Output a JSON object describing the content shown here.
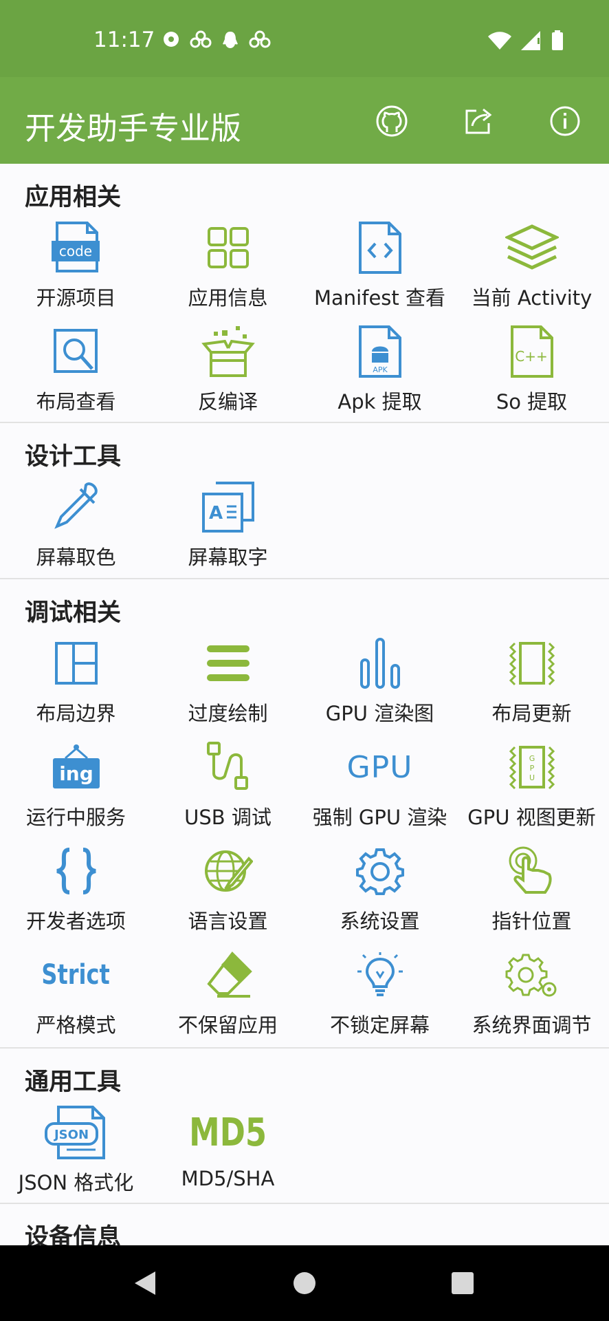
{
  "status": {
    "time": "11:17",
    "left_icons": [
      "record-icon",
      "cloud-icon",
      "qq-icon",
      "cloud-icon"
    ],
    "right_icons": [
      "wifi-icon",
      "signal-icon",
      "battery-icon"
    ]
  },
  "app": {
    "title": "开发助手专业版",
    "actions": [
      "github-icon",
      "share-icon",
      "info-icon"
    ]
  },
  "colors": {
    "green": "#71ab47",
    "green_dark": "#6ba443",
    "blue": "#3d8fd1",
    "lime": "#8cb83c"
  },
  "sections": [
    {
      "title": "应用相关",
      "items": [
        {
          "label": "开源项目",
          "icon": "code-file-icon"
        },
        {
          "label": "应用信息",
          "icon": "grid-icon"
        },
        {
          "label": "Manifest 查看",
          "icon": "code-doc-icon"
        },
        {
          "label": "当前 Activity",
          "icon": "layers-icon"
        },
        {
          "label": "布局查看",
          "icon": "layout-search-icon"
        },
        {
          "label": "反编译",
          "icon": "open-box-icon"
        },
        {
          "label": "Apk 提取",
          "icon": "apk-file-icon"
        },
        {
          "label": "So 提取",
          "icon": "cpp-file-icon"
        }
      ]
    },
    {
      "title": "设计工具",
      "items": [
        {
          "label": "屏幕取色",
          "icon": "eyedropper-icon"
        },
        {
          "label": "屏幕取字",
          "icon": "text-copy-icon"
        }
      ]
    },
    {
      "title": "调试相关",
      "items": [
        {
          "label": "布局边界",
          "icon": "layout-bounds-icon"
        },
        {
          "label": "过度绘制",
          "icon": "menu-lines-icon"
        },
        {
          "label": "GPU 渲染图",
          "icon": "bar-chart-icon"
        },
        {
          "label": "布局更新",
          "icon": "layout-update-icon"
        },
        {
          "label": "运行中服务",
          "icon": "ing-sign-icon"
        },
        {
          "label": "USB 调试",
          "icon": "usb-cable-icon"
        },
        {
          "label": "强制 GPU 渲染",
          "icon": "gpu-text-icon",
          "icon_text": "GPU"
        },
        {
          "label": "GPU 视图更新",
          "icon": "gpu-chip-icon"
        },
        {
          "label": "开发者选项",
          "icon": "braces-icon"
        },
        {
          "label": "语言设置",
          "icon": "globe-pen-icon"
        },
        {
          "label": "系统设置",
          "icon": "gear-icon"
        },
        {
          "label": "指针位置",
          "icon": "pointer-hand-icon"
        },
        {
          "label": "严格模式",
          "icon": "strict-text-icon",
          "icon_text": "Strict"
        },
        {
          "label": "不保留应用",
          "icon": "eraser-icon"
        },
        {
          "label": "不锁定屏幕",
          "icon": "bulb-icon"
        },
        {
          "label": "系统界面调节",
          "icon": "gears-icon"
        }
      ]
    },
    {
      "title": "通用工具",
      "items": [
        {
          "label": "JSON 格式化",
          "icon": "json-file-icon",
          "icon_text": "JSON"
        },
        {
          "label": "MD5/SHA",
          "icon": "md5-text-icon",
          "icon_text": "MD5"
        }
      ]
    },
    {
      "title": "设备信息",
      "items": []
    }
  ],
  "nav": [
    "back-icon",
    "home-icon",
    "recents-icon"
  ]
}
